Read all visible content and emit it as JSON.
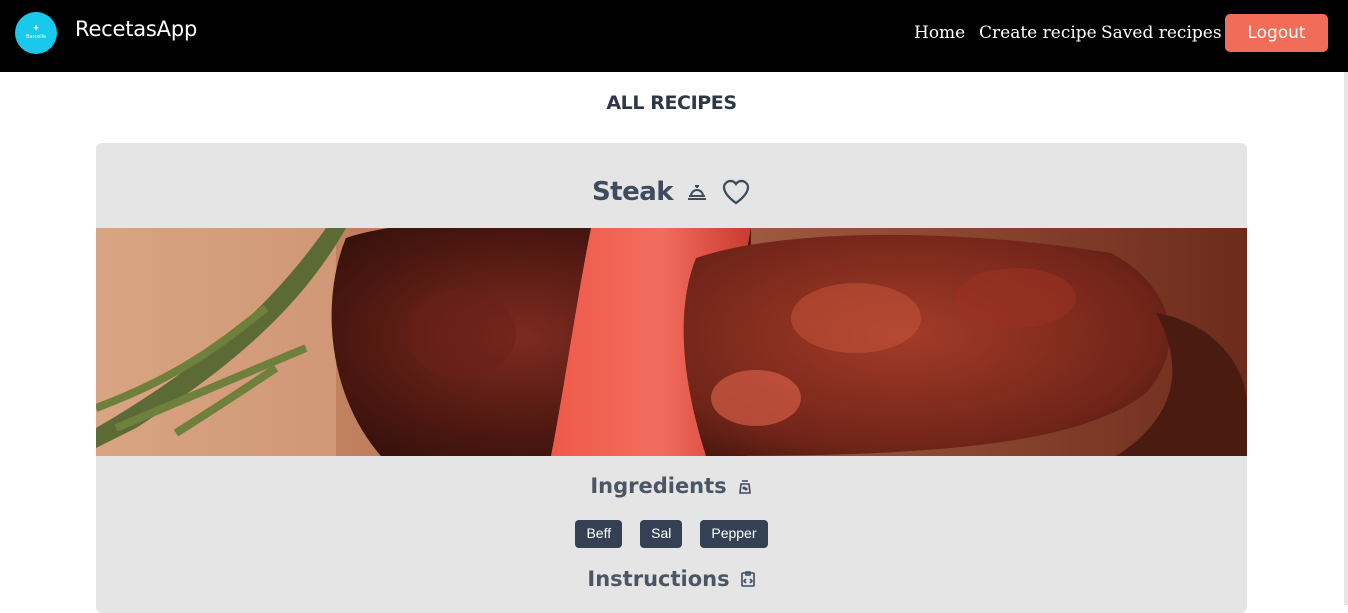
{
  "navbar": {
    "logo_text": "Barcelle",
    "brand": "RecetasApp",
    "links": [
      "Home",
      "Create recipe",
      "Saved recipes"
    ],
    "logout_label": "Logout"
  },
  "page": {
    "title": "ALL RECIPES"
  },
  "recipe": {
    "title": "Steak",
    "ingredients_title": "Ingredients",
    "ingredients": [
      "Beff",
      "Sal",
      "Pepper"
    ],
    "instructions_title": "Instructions",
    "title_icons": [
      "cloche-icon",
      "heart-icon"
    ],
    "ingredients_icon": "salt-shaker-icon",
    "instructions_icon": "clipboard-code-icon",
    "image_alt_note": "steak photo"
  },
  "colors": {
    "navbar_bg": "#000000",
    "logo_bg": "#19c9ec",
    "logout_bg": "#f26d58",
    "card_bg": "#e5e5e5",
    "tag_bg": "#344054",
    "heading_text": "#3f4b5e"
  }
}
